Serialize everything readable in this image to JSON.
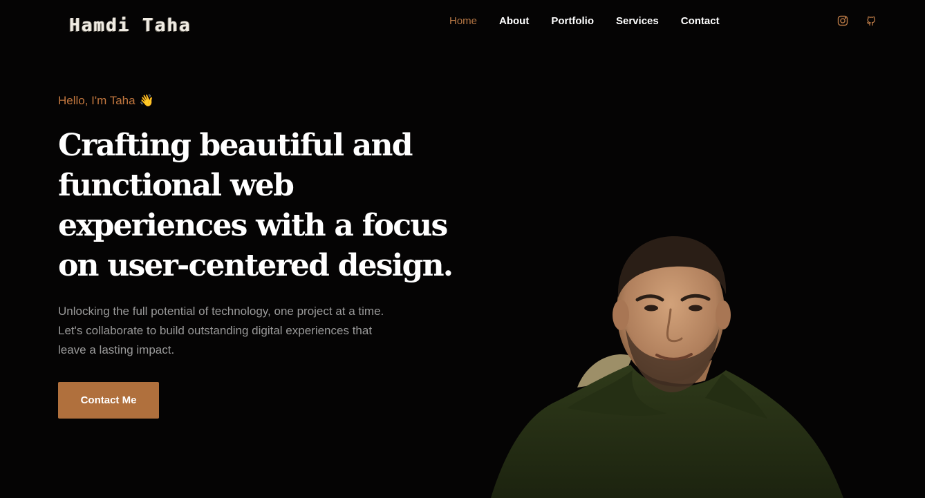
{
  "header": {
    "logo": "Hamdi Taha",
    "nav": [
      {
        "label": "Home",
        "active": true
      },
      {
        "label": "About",
        "active": false
      },
      {
        "label": "Portfolio",
        "active": false
      },
      {
        "label": "Services",
        "active": false
      },
      {
        "label": "Contact",
        "active": false
      }
    ],
    "socials": [
      {
        "icon": "instagram-icon"
      },
      {
        "icon": "github-icon"
      }
    ]
  },
  "hero": {
    "greeting": "Hello, I'm Taha",
    "greeting_emoji": "👋",
    "headline": "Crafting beautiful and functional web experiences with a focus on user-centered design.",
    "description": "Unlocking the full potential of technology, one project at a time. Let's collaborate to build outstanding digital experiences that leave a lasting impact.",
    "cta_label": "Contact Me",
    "portrait": "profile-photo"
  },
  "colors": {
    "background": "#050404",
    "accent": "#b0703d",
    "active_nav": "#b87845",
    "body_text": "#9a9a9a",
    "heading": "#ffffff"
  }
}
